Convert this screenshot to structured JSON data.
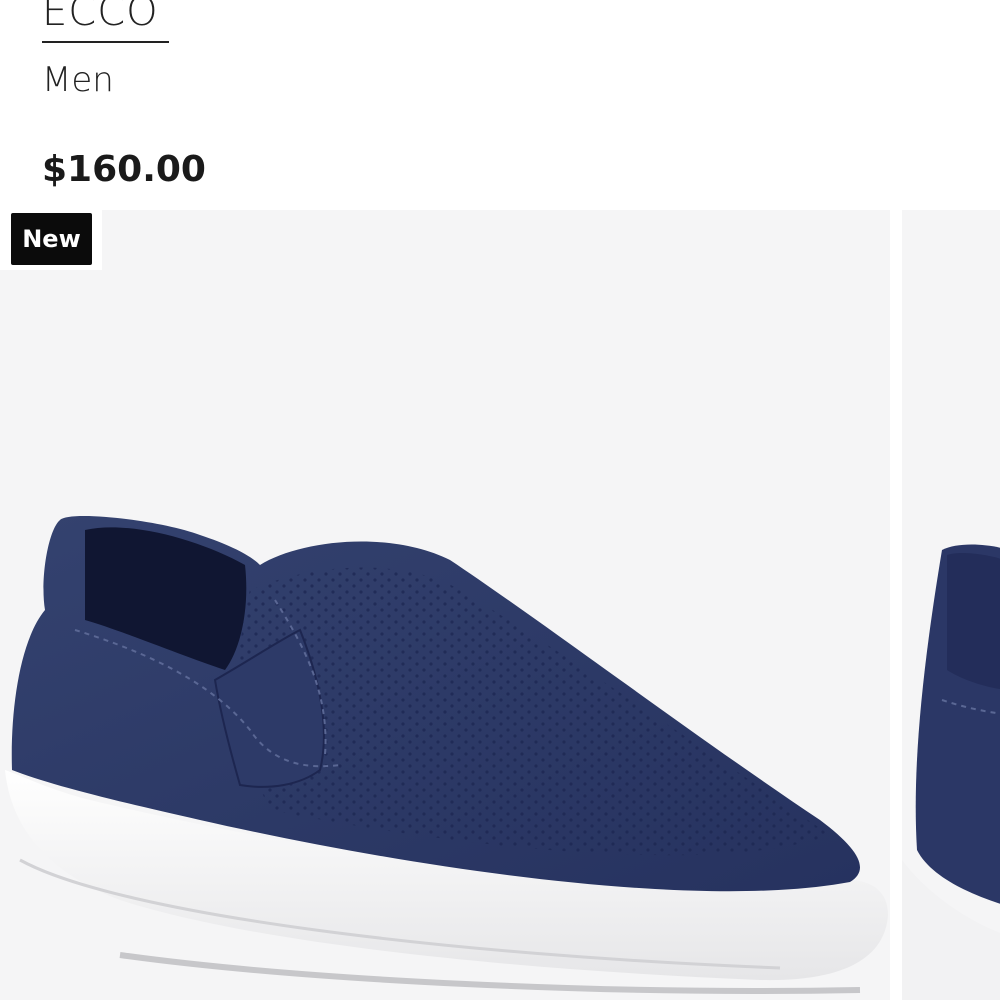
{
  "product": {
    "brand": "ECCO",
    "gender": "Men",
    "price": "$160.00",
    "badge": "New"
  },
  "colors": {
    "shoe_upper": "#2a3766",
    "sole": "#f4f4f4",
    "image_background": "#f5f5f6",
    "badge_background": "#0b0b0b"
  },
  "gallery": {
    "images": [
      {
        "name": "product-image-1",
        "subject": "navy slip-on shoe"
      },
      {
        "name": "product-image-2",
        "subject": "navy slip-on shoe (partial)"
      }
    ]
  }
}
